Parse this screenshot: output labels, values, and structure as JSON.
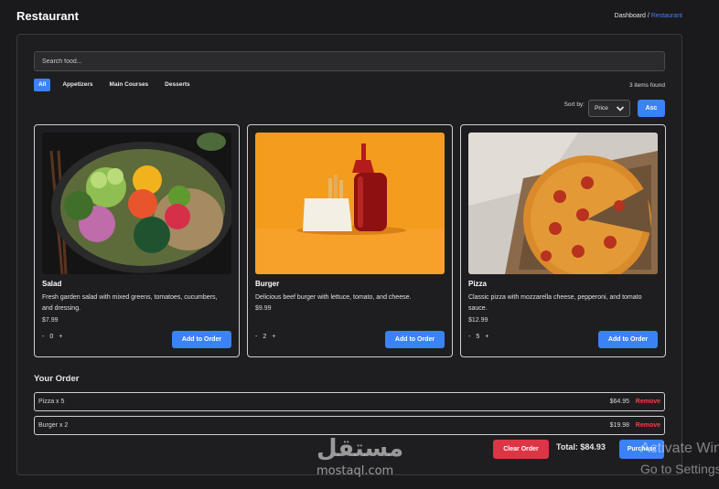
{
  "header": {
    "title": "Restaurant",
    "breadcrumb": {
      "parent": "Dashboard",
      "separator": " / ",
      "current": "Restaurant"
    }
  },
  "search": {
    "placeholder": "Search food...",
    "value": ""
  },
  "filters": {
    "tabs": [
      "All",
      "Appetizers",
      "Main Courses",
      "Desserts"
    ],
    "selected": "All"
  },
  "results": {
    "count_text": "3 items found"
  },
  "sort": {
    "label": "Sort by:",
    "selected": "Price",
    "direction_label": "Asc"
  },
  "menu": [
    {
      "name": "Salad",
      "description": "Fresh garden salad with mixed greens, tomatoes, cucumbers, and dressing.",
      "price": "$7.99",
      "minus": "-",
      "quantity": "0",
      "plus": "+",
      "button": "Add to Order",
      "image": "salad-bowl-photo"
    },
    {
      "name": "Burger",
      "description": "Delicious beef burger with lettuce, tomato, and cheese.",
      "price": "$9.99",
      "minus": "-",
      "quantity": "2",
      "plus": "+",
      "button": "Add to Order",
      "image": "fries-and-ketchup-photo"
    },
    {
      "name": "Pizza",
      "description": "Classic pizza with mozzarella cheese, pepperoni, and tomato sauce.",
      "price": "$12.99",
      "minus": "-",
      "quantity": "5",
      "plus": "+",
      "button": "Add to Order",
      "image": "pepperoni-pizza-photo"
    }
  ],
  "order": {
    "title": "Your Order",
    "items": [
      {
        "label": "Pizza  x 5",
        "amount": "$64.95",
        "remove": "Remove"
      },
      {
        "label": "Burger  x 2",
        "amount": "$19.98",
        "remove": "Remove"
      }
    ],
    "clear_label": "Clear Order",
    "total_label": "Total: $84.93",
    "purchase_label": "Purchase"
  },
  "watermark": {
    "logo_text": "مستقل",
    "url": "mostaql.com"
  },
  "os_overlay": {
    "line1": "Activate Windows",
    "line2": "Go to Settings to activate Windows."
  },
  "colors": {
    "accent": "#3b82f6",
    "danger": "#dc3545",
    "remove": "#ef4444",
    "background": "#1a1a1d"
  }
}
